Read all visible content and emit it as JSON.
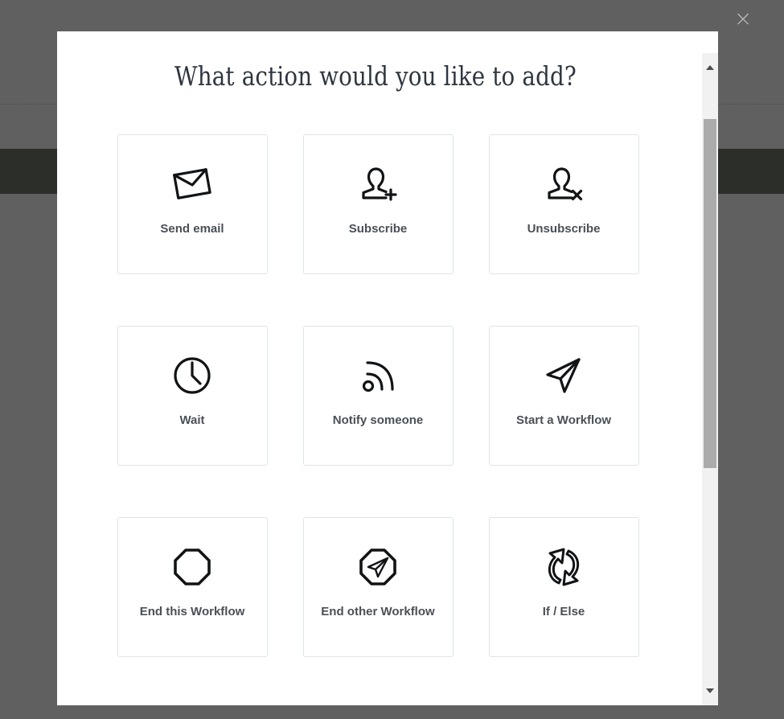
{
  "background": {
    "overlay_color": "#222222",
    "band_color": "#455139"
  },
  "dialog": {
    "title": "What action would you like to add?",
    "close_label": "×",
    "close_icon": "close-icon"
  },
  "scrollbar": {
    "up_icon": "chevron-up-icon",
    "down_icon": "chevron-down-icon",
    "track_color": "#f1f1f1",
    "thumb_color": "#ababab"
  },
  "actions": [
    {
      "id": "send-email",
      "label": "Send email",
      "icon": "envelope-icon"
    },
    {
      "id": "subscribe",
      "label": "Subscribe",
      "icon": "user-plus-icon"
    },
    {
      "id": "unsubscribe",
      "label": "Unsubscribe",
      "icon": "user-remove-icon"
    },
    {
      "id": "wait",
      "label": "Wait",
      "icon": "clock-icon"
    },
    {
      "id": "notify-someone",
      "label": "Notify someone",
      "icon": "broadcast-icon"
    },
    {
      "id": "start-a-workflow",
      "label": "Start a Workflow",
      "icon": "paper-plane-icon"
    },
    {
      "id": "end-this-workflow",
      "label": "End this Workflow",
      "icon": "octagon-icon"
    },
    {
      "id": "end-other-workflow",
      "label": "End other Workflow",
      "icon": "octagon-arrow-icon"
    },
    {
      "id": "if-else",
      "label": "If / Else",
      "icon": "branch-arrows-icon"
    }
  ]
}
